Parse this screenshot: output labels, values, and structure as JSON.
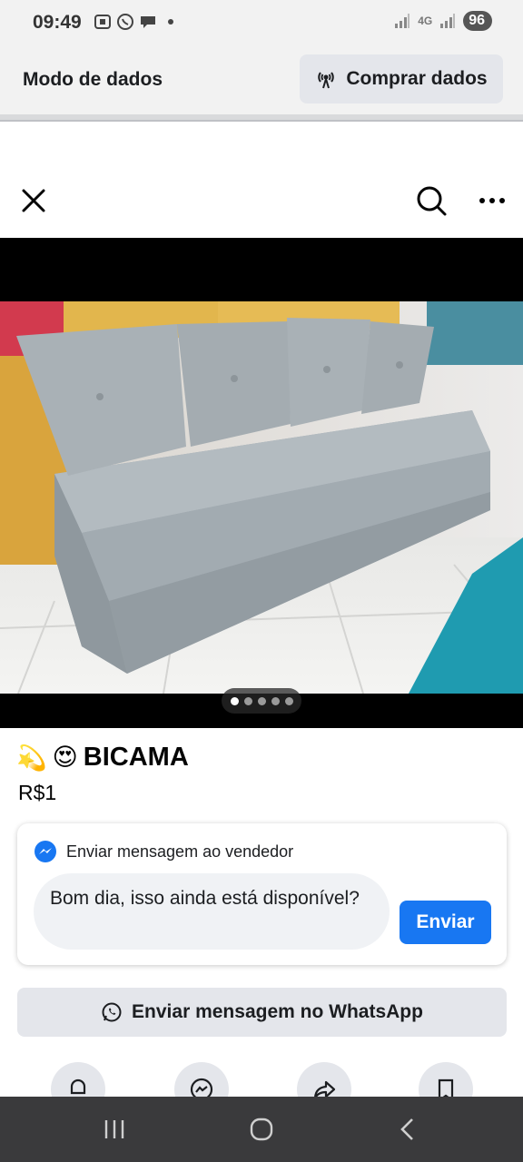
{
  "status_bar": {
    "time": "09:49",
    "network": "4G",
    "battery": "96"
  },
  "data_bar": {
    "mode_label": "Modo de dados",
    "buy_label": "Comprar dados"
  },
  "nav": {
    "close_icon": "close-icon",
    "search_icon": "search-icon",
    "more_icon": "more-icon"
  },
  "photo": {
    "image_count": 5,
    "active_index": 0
  },
  "listing": {
    "title_emoji_1": "💫",
    "title_emoji_2": "😍",
    "title": "BICAMA",
    "price": "R$1"
  },
  "message_card": {
    "header": "Enviar mensagem ao vendedor",
    "draft": "Bom dia, isso ainda está disponível?",
    "send_label": "Enviar"
  },
  "whatsapp": {
    "label": "Enviar mensagem no WhatsApp"
  },
  "actions": [
    "bell-icon",
    "messenger-icon",
    "share-icon",
    "save-icon"
  ],
  "colors": {
    "accent": "#1877f2",
    "button_gray": "#e4e6eb",
    "status_bg": "#f2f2f2",
    "nav_bg": "#3a3a3c"
  }
}
